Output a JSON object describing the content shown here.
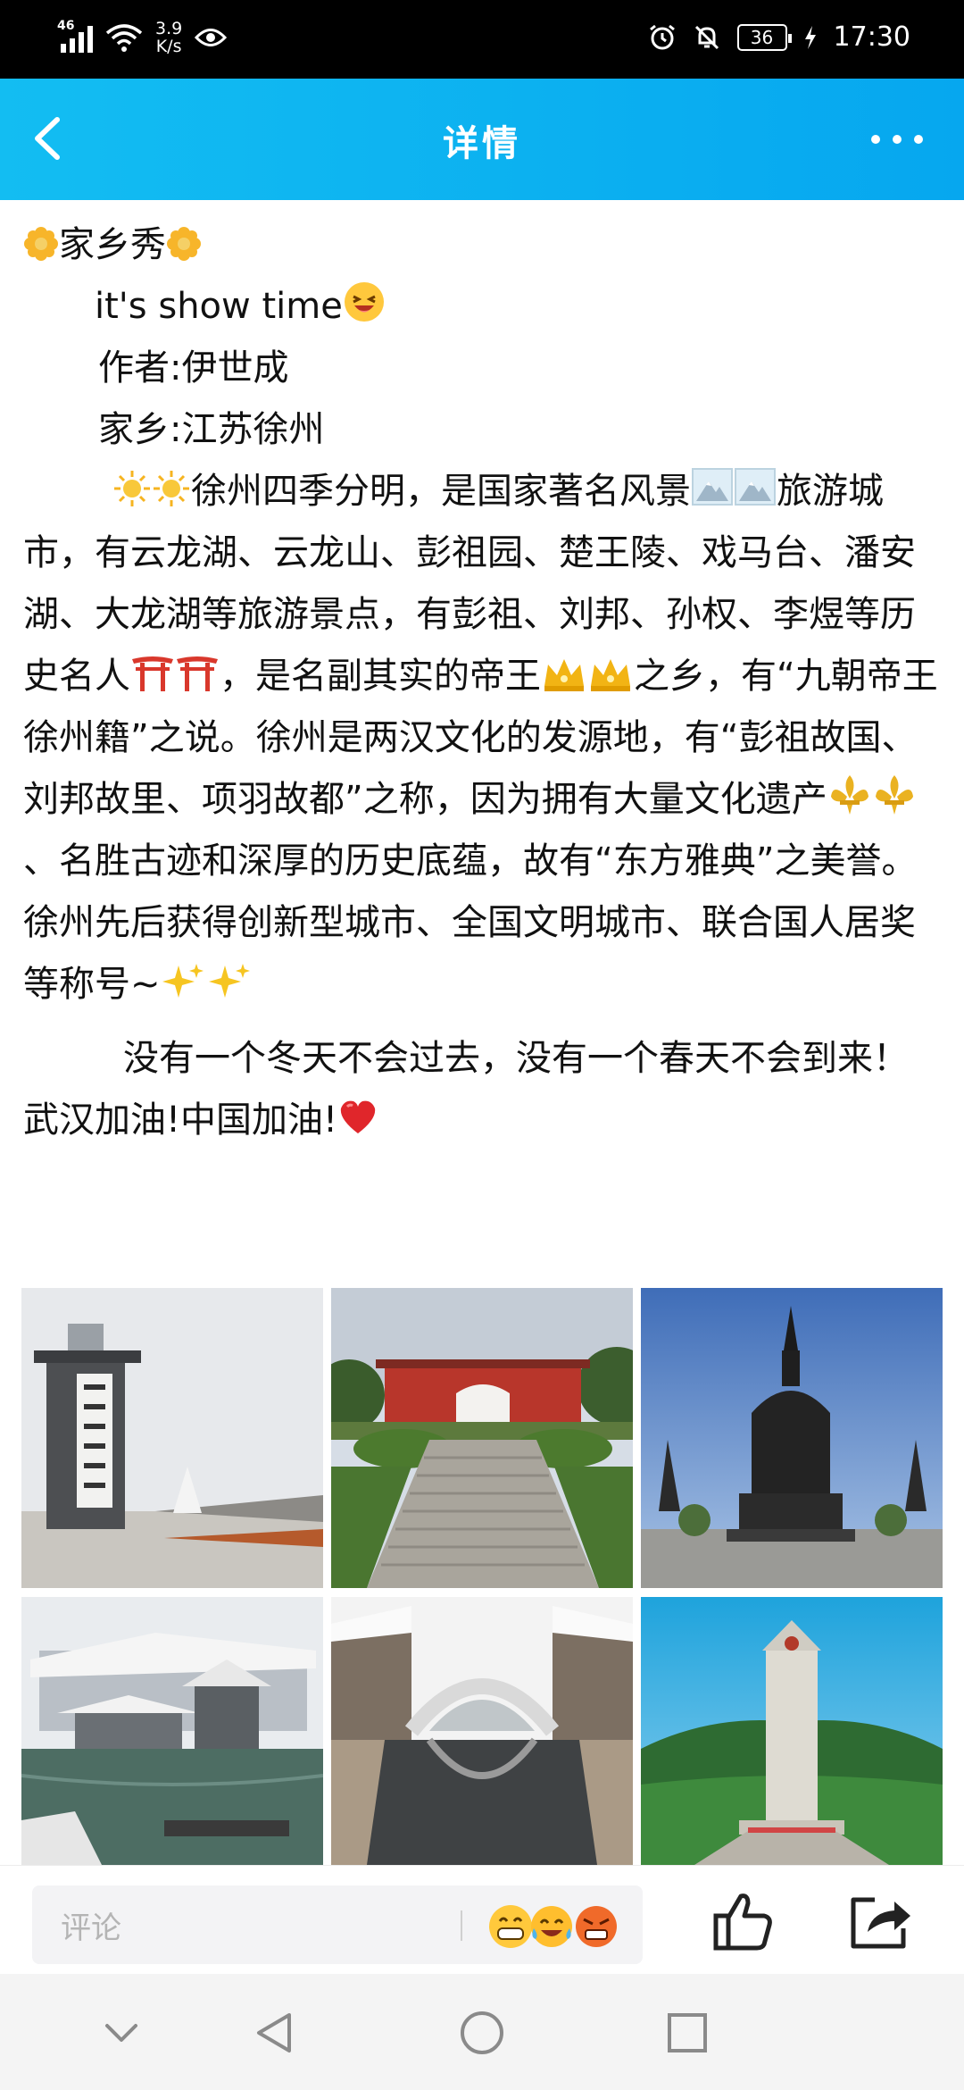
{
  "status_bar": {
    "network": "46",
    "speed_value": "3.9",
    "speed_unit": "K/s",
    "battery": "36",
    "time": "17:30"
  },
  "header": {
    "title": "详情"
  },
  "article": {
    "title": "家乡秀",
    "tagline": "it's show time",
    "author": "作者:伊世成",
    "hometown": "家乡:江苏徐州",
    "p1_a": "徐州四季分明，是国家著名风景",
    "p1_b": "旅游城市，有云龙湖、云龙山、彭祖园、楚王陵、戏马台、潘安湖、大龙湖等旅游景点，有彭祖、刘邦、孙权、李煜等历史名人",
    "p1_c": "，是名副其实的帝王",
    "p1_d": "之乡，有“九朝帝王徐州籍”之说。徐州是两汉文化的发源地，有“彭祖故国、刘邦故里、项羽故都”之称，因为拥有大量文化遗产",
    "p1_e": "、名胜古迹和深厚的历史底蕴，故有“东方雅典”之美誉。徐州先后获得创新型城市、全国文明城市、联合国人居奖等称号~",
    "p2": "没有一个冬天不会过去，没有一个春天不会到来！武汉加油!中国加油!"
  },
  "photos": [
    {
      "icon": "park-gate-photo"
    },
    {
      "icon": "red-gate-stairs-photo"
    },
    {
      "icon": "pagoda-monument-photo"
    },
    {
      "icon": "snow-pavilion-lake-photo"
    },
    {
      "icon": "canal-bridge-photo"
    },
    {
      "icon": "memorial-tower-photo"
    }
  ],
  "bottom_bar": {
    "comment_placeholder": "评论"
  },
  "colors": {
    "header_start": "#13bdf2",
    "header_end": "#06a7ef",
    "status_bar": "#000000",
    "placeholder": "#b4b4b4"
  }
}
